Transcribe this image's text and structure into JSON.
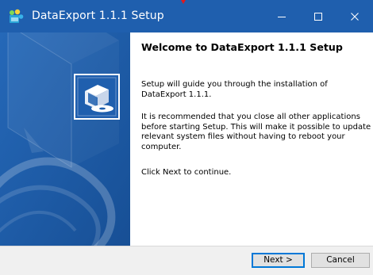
{
  "window": {
    "title": "DataExport 1.1.1 Setup",
    "icons": {
      "app": "installer-app-icon",
      "minimize": "minimize-icon",
      "maximize": "maximize-icon",
      "close": "close-icon",
      "banner": "installer-box-icon"
    }
  },
  "content": {
    "heading": "Welcome to DataExport 1.1.1 Setup",
    "paragraphs": [
      "Setup will guide you through the installation of DataExport 1.1.1.",
      "It is recommended that you close all other applications before starting Setup. This will make it possible to update relevant system files without having to reboot your computer.",
      "Click Next to continue."
    ]
  },
  "buttons": {
    "next": "Next >",
    "cancel": "Cancel"
  },
  "colors": {
    "accent": "#1f5fae",
    "focus_border": "#0078d7",
    "annotation_arrow": "#e0191e"
  }
}
